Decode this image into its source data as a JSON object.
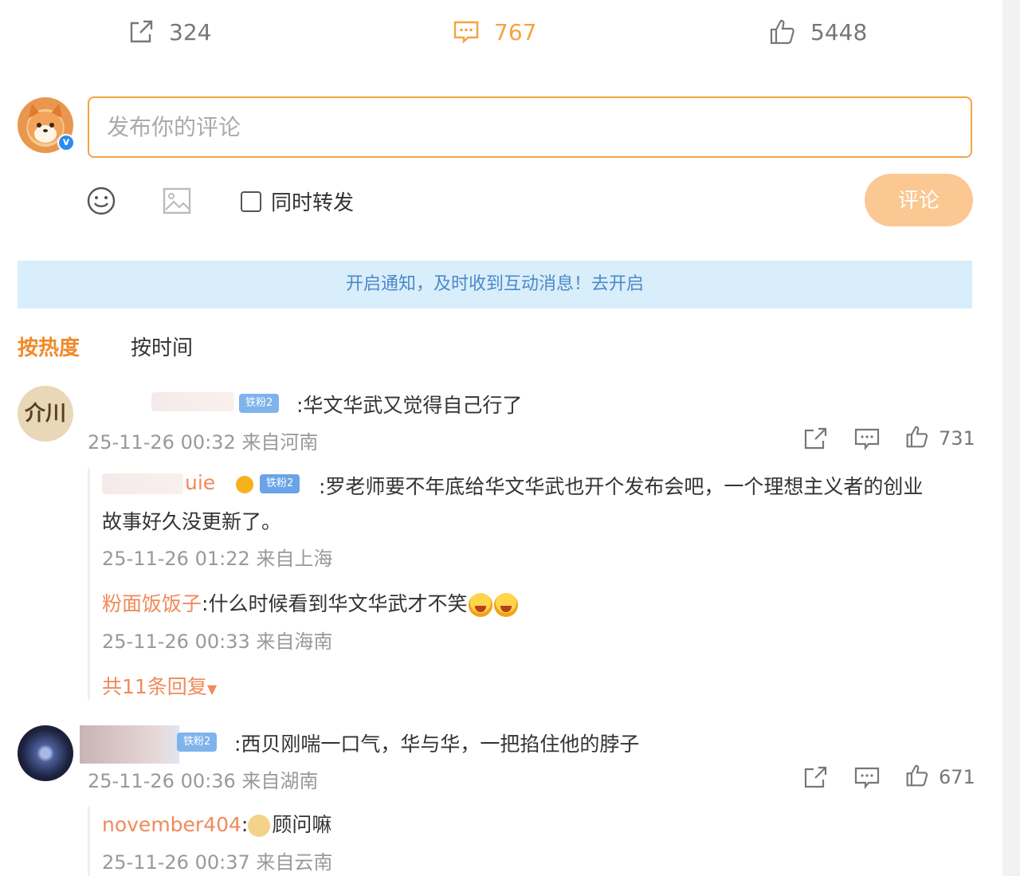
{
  "actions": {
    "repost_count": "324",
    "comment_count": "767",
    "like_count": "5448"
  },
  "composer": {
    "placeholder": "发布你的评论",
    "sync_label": "同时转发",
    "submit_label": "评论"
  },
  "notice": "开启通知，及时收到互动消息！去开启",
  "sort": {
    "hot": "按热度",
    "time": "按时间"
  },
  "comments": [
    {
      "avatar_text": "介川",
      "badge": "铁粉2",
      "text": ":华文华武又觉得自己行了",
      "meta": "25-11-26 00:32 来自河南",
      "likes": "731",
      "replies": [
        {
          "user": "uie",
          "badge": "铁粉2",
          "text": ":罗老师要不年底给华文华武也开个发布会吧，一个理想主义者的创业",
          "text2": "故事好久没更新了。",
          "meta": "25-11-26 01:22 来自上海"
        },
        {
          "user": "粉面饭饭子",
          "text": ":什么时候看到华文华武才不笑",
          "meta": "25-11-26 00:33 来自海南"
        }
      ],
      "more_replies": "共11条回复"
    },
    {
      "badge": "铁粉2",
      "text": ":西贝刚喘一口气，华与华，一把掐住他的脖子",
      "meta": "25-11-26 00:36 来自湖南",
      "likes": "671",
      "replies": [
        {
          "user": "november404",
          "text": "顾问嘛",
          "meta": "25-11-26 00:37 来自云南"
        }
      ]
    }
  ],
  "colors": {
    "accent": "#f5a342",
    "username": "#f08a5a",
    "notice_bg": "#d9eefb",
    "notice_text": "#4d88c9"
  }
}
